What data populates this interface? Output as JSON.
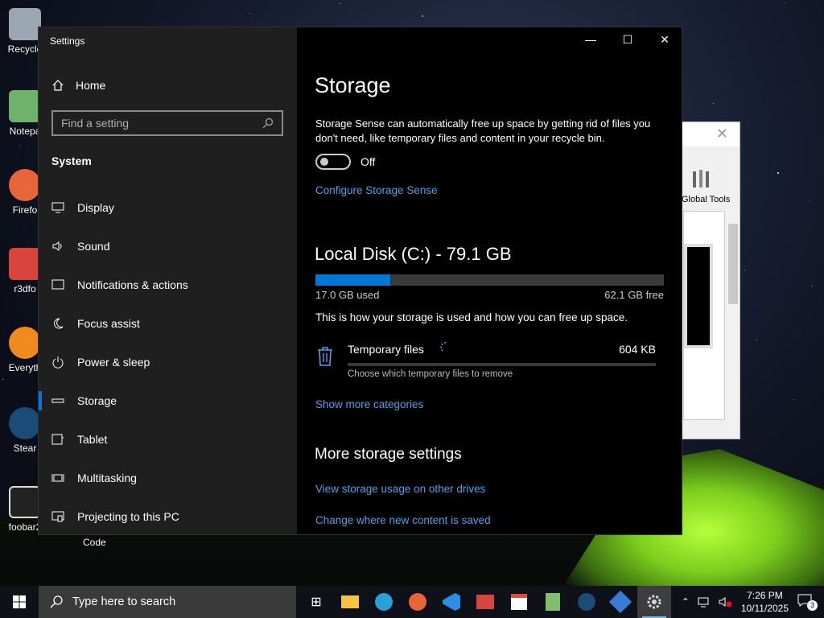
{
  "desktop": {
    "icons": [
      {
        "label": "Recycle",
        "color": "#9aa6b2"
      },
      {
        "label": "Notepa",
        "color": "#6fb36a"
      },
      {
        "label": "Firefo",
        "color": "#e8653a"
      },
      {
        "label": "r3dfo",
        "color": "#d7453d"
      },
      {
        "label": "Everyth",
        "color": "#f08a1c"
      },
      {
        "label": "Stear",
        "color": "#1b4c78"
      },
      {
        "label": "foobar2",
        "color": "#222222"
      }
    ],
    "code_label": "Code"
  },
  "background_window": {
    "tool_label": "Global Tools"
  },
  "settings": {
    "window_title": "Settings",
    "home_label": "Home",
    "search_placeholder": "Find a setting",
    "section_title": "System",
    "nav": [
      {
        "label": "Display",
        "icon": "monitor-icon"
      },
      {
        "label": "Sound",
        "icon": "speaker-icon"
      },
      {
        "label": "Notifications & actions",
        "icon": "notification-icon"
      },
      {
        "label": "Focus assist",
        "icon": "moon-icon"
      },
      {
        "label": "Power & sleep",
        "icon": "power-icon"
      },
      {
        "label": "Storage",
        "icon": "storage-icon",
        "active": true
      },
      {
        "label": "Tablet",
        "icon": "tablet-icon"
      },
      {
        "label": "Multitasking",
        "icon": "multitasking-icon"
      },
      {
        "label": "Projecting to this PC",
        "icon": "projecting-icon"
      }
    ],
    "page": {
      "title": "Storage",
      "description": "Storage Sense can automatically free up space by getting rid of files you don't need, like temporary files and content in your recycle bin.",
      "toggle_state": "Off",
      "configure_link": "Configure Storage Sense",
      "disk_title": "Local Disk (C:) - 79.1 GB",
      "used_label": "17.0 GB used",
      "free_label": "62.1 GB free",
      "used_fraction": 0.215,
      "usage_hint": "This is how your storage is used and how you can free up space.",
      "temp_files": {
        "name": "Temporary files",
        "size": "604 KB",
        "subtitle": "Choose which temporary files to remove"
      },
      "show_more_link": "Show more categories",
      "more_title": "More storage settings",
      "link_other_drives": "View storage usage on other drives",
      "link_new_content": "Change where new content is saved"
    }
  },
  "taskbar": {
    "search_placeholder": "Type here to search",
    "time": "7:26 PM",
    "date": "10/11/2025",
    "notification_count": "3",
    "accent": "#0078d7"
  }
}
